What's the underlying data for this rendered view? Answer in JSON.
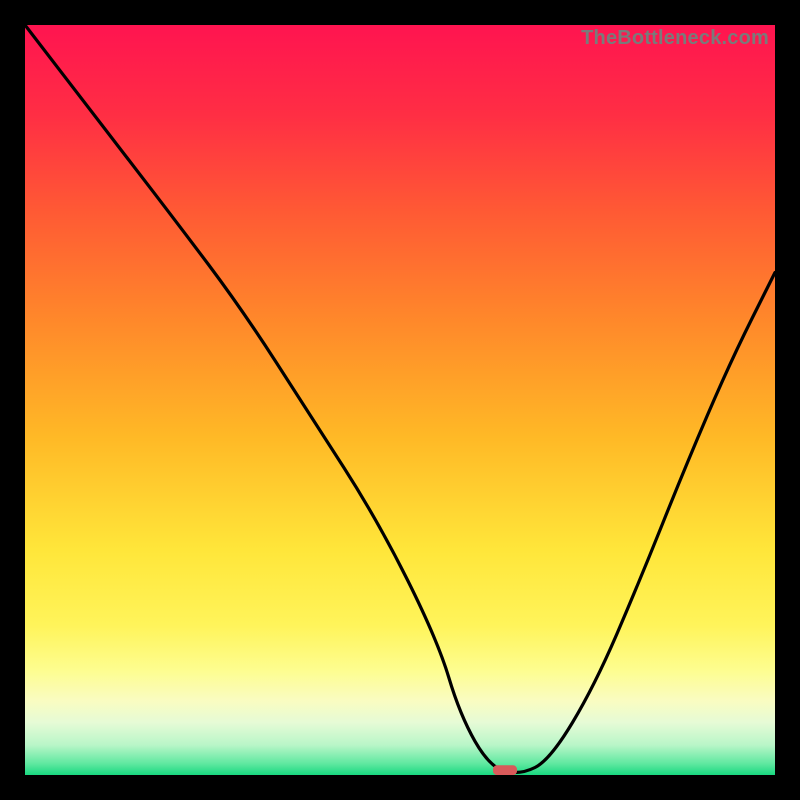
{
  "watermark": "TheBottleneck.com",
  "chart_data": {
    "type": "line",
    "title": "",
    "xlabel": "",
    "ylabel": "",
    "xlim": [
      0,
      100
    ],
    "ylim": [
      0,
      100
    ],
    "series": [
      {
        "name": "bottleneck-curve",
        "x": [
          0,
          10,
          20,
          29,
          38,
          47,
          55,
          58,
          62,
          66,
          70,
          76,
          82,
          88,
          94,
          100
        ],
        "y": [
          100,
          87,
          74,
          62,
          48,
          34,
          18,
          8,
          1,
          0,
          2,
          12,
          26,
          41,
          55,
          67
        ]
      }
    ],
    "marker": {
      "x": 64,
      "y": 0,
      "width": 3.2,
      "height": 1.3,
      "color": "#d85a5a"
    },
    "gradient_stops": [
      {
        "offset": 0.0,
        "color": "#ff1450"
      },
      {
        "offset": 0.12,
        "color": "#ff2e44"
      },
      {
        "offset": 0.25,
        "color": "#ff5a34"
      },
      {
        "offset": 0.4,
        "color": "#ff8a2a"
      },
      {
        "offset": 0.55,
        "color": "#ffb926"
      },
      {
        "offset": 0.7,
        "color": "#ffe63a"
      },
      {
        "offset": 0.8,
        "color": "#fff45a"
      },
      {
        "offset": 0.86,
        "color": "#fdfd8f"
      },
      {
        "offset": 0.9,
        "color": "#fafcc0"
      },
      {
        "offset": 0.93,
        "color": "#e6fbd6"
      },
      {
        "offset": 0.96,
        "color": "#b9f6c8"
      },
      {
        "offset": 0.985,
        "color": "#5fe8a0"
      },
      {
        "offset": 1.0,
        "color": "#18d880"
      }
    ]
  }
}
